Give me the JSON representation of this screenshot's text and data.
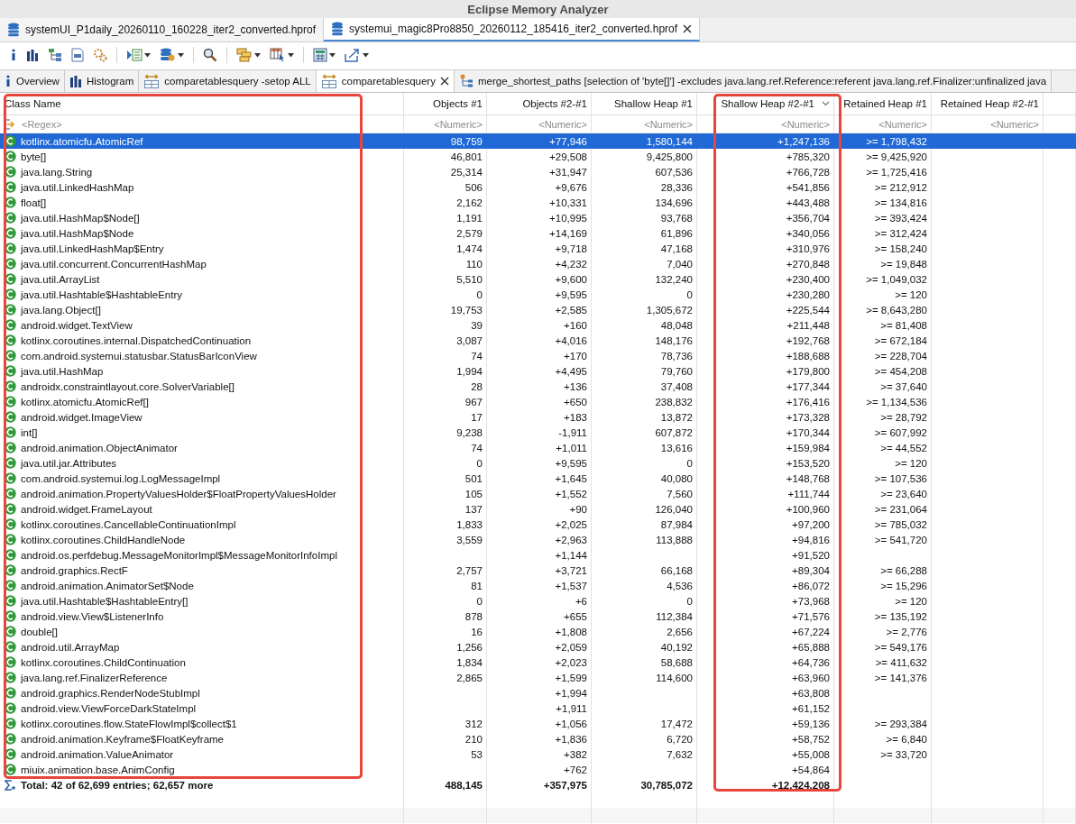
{
  "window": {
    "title": "Eclipse Memory Analyzer"
  },
  "editor_tabs": [
    {
      "label": "systemUI_P1daily_20260110_160228_iter2_converted.hprof",
      "selected": false
    },
    {
      "label": "systemui_magic8Pro8850_20260112_185416_iter2_converted.hprof",
      "selected": true
    }
  ],
  "view_tabs": [
    {
      "kind": "info",
      "label": "Overview",
      "selected": false
    },
    {
      "kind": "histogram",
      "label": "Histogram",
      "selected": false
    },
    {
      "kind": "compare",
      "label": "comparetablesquery -setop ALL",
      "selected": false
    },
    {
      "kind": "compare",
      "label": "comparetablesquery",
      "selected": true
    },
    {
      "kind": "tree",
      "label": "merge_shortest_paths [selection of 'byte[]'] -excludes java.lang.ref.Reference:referent java.lang.ref.Finalizer:unfinalized java",
      "selected": false
    }
  ],
  "table": {
    "columns": [
      {
        "label": "Class Name",
        "filter": "<Regex>",
        "sorted": false,
        "highlighted": true
      },
      {
        "label": "Objects #1",
        "filter": "<Numeric>",
        "sorted": false,
        "highlighted": false
      },
      {
        "label": "Objects #2-#1",
        "filter": "<Numeric>",
        "sorted": false,
        "highlighted": false
      },
      {
        "label": "Shallow Heap #1",
        "filter": "<Numeric>",
        "sorted": false,
        "highlighted": false
      },
      {
        "label": "Shallow Heap #2-#1",
        "filter": "<Numeric>",
        "sorted": true,
        "highlighted": true
      },
      {
        "label": "Retained Heap #1",
        "filter": "<Numeric>",
        "sorted": false,
        "highlighted": false
      },
      {
        "label": "Retained Heap #2-#1",
        "filter": "<Numeric>",
        "sorted": false,
        "highlighted": false
      }
    ],
    "rows": [
      {
        "selected": true,
        "cells": [
          "kotlinx.atomicfu.AtomicRef",
          "98,759",
          "+77,946",
          "1,580,144",
          "+1,247,136",
          ">= 1,798,432"
        ]
      },
      {
        "selected": false,
        "cells": [
          "byte[]",
          "46,801",
          "+29,508",
          "9,425,800",
          "+785,320",
          ">= 9,425,920"
        ]
      },
      {
        "selected": false,
        "cells": [
          "java.lang.String",
          "25,314",
          "+31,947",
          "607,536",
          "+766,728",
          ">= 1,725,416"
        ]
      },
      {
        "selected": false,
        "cells": [
          "java.util.LinkedHashMap",
          "506",
          "+9,676",
          "28,336",
          "+541,856",
          ">= 212,912"
        ]
      },
      {
        "selected": false,
        "cells": [
          "float[]",
          "2,162",
          "+10,331",
          "134,696",
          "+443,488",
          ">= 134,816"
        ]
      },
      {
        "selected": false,
        "cells": [
          "java.util.HashMap$Node[]",
          "1,191",
          "+10,995",
          "93,768",
          "+356,704",
          ">= 393,424"
        ]
      },
      {
        "selected": false,
        "cells": [
          "java.util.HashMap$Node",
          "2,579",
          "+14,169",
          "61,896",
          "+340,056",
          ">= 312,424"
        ]
      },
      {
        "selected": false,
        "cells": [
          "java.util.LinkedHashMap$Entry",
          "1,474",
          "+9,718",
          "47,168",
          "+310,976",
          ">= 158,240"
        ]
      },
      {
        "selected": false,
        "cells": [
          "java.util.concurrent.ConcurrentHashMap",
          "110",
          "+4,232",
          "7,040",
          "+270,848",
          ">= 19,848"
        ]
      },
      {
        "selected": false,
        "cells": [
          "java.util.ArrayList",
          "5,510",
          "+9,600",
          "132,240",
          "+230,400",
          ">= 1,049,032"
        ]
      },
      {
        "selected": false,
        "cells": [
          "java.util.Hashtable$HashtableEntry",
          "0",
          "+9,595",
          "0",
          "+230,280",
          ">= 120"
        ]
      },
      {
        "selected": false,
        "cells": [
          "java.lang.Object[]",
          "19,753",
          "+2,585",
          "1,305,672",
          "+225,544",
          ">= 8,643,280"
        ]
      },
      {
        "selected": false,
        "cells": [
          "android.widget.TextView",
          "39",
          "+160",
          "48,048",
          "+211,448",
          ">= 81,408"
        ]
      },
      {
        "selected": false,
        "cells": [
          "kotlinx.coroutines.internal.DispatchedContinuation",
          "3,087",
          "+4,016",
          "148,176",
          "+192,768",
          ">= 672,184"
        ]
      },
      {
        "selected": false,
        "cells": [
          "com.android.systemui.statusbar.StatusBarIconView",
          "74",
          "+170",
          "78,736",
          "+188,688",
          ">= 228,704"
        ]
      },
      {
        "selected": false,
        "cells": [
          "java.util.HashMap",
          "1,994",
          "+4,495",
          "79,760",
          "+179,800",
          ">= 454,208"
        ]
      },
      {
        "selected": false,
        "cells": [
          "androidx.constraintlayout.core.SolverVariable[]",
          "28",
          "+136",
          "37,408",
          "+177,344",
          ">= 37,640"
        ]
      },
      {
        "selected": false,
        "cells": [
          "kotlinx.atomicfu.AtomicRef[]",
          "967",
          "+650",
          "238,832",
          "+176,416",
          ">= 1,134,536"
        ]
      },
      {
        "selected": false,
        "cells": [
          "android.widget.ImageView",
          "17",
          "+183",
          "13,872",
          "+173,328",
          ">= 28,792"
        ]
      },
      {
        "selected": false,
        "cells": [
          "int[]",
          "9,238",
          "-1,911",
          "607,872",
          "+170,344",
          ">= 607,992"
        ]
      },
      {
        "selected": false,
        "cells": [
          "android.animation.ObjectAnimator",
          "74",
          "+1,011",
          "13,616",
          "+159,984",
          ">= 44,552"
        ]
      },
      {
        "selected": false,
        "cells": [
          "java.util.jar.Attributes",
          "0",
          "+9,595",
          "0",
          "+153,520",
          ">= 120"
        ]
      },
      {
        "selected": false,
        "cells": [
          "com.android.systemui.log.LogMessageImpl",
          "501",
          "+1,645",
          "40,080",
          "+148,768",
          ">= 107,536"
        ]
      },
      {
        "selected": false,
        "cells": [
          "android.animation.PropertyValuesHolder$FloatPropertyValuesHolder",
          "105",
          "+1,552",
          "7,560",
          "+111,744",
          ">= 23,640"
        ]
      },
      {
        "selected": false,
        "cells": [
          "android.widget.FrameLayout",
          "137",
          "+90",
          "126,040",
          "+100,960",
          ">= 231,064"
        ]
      },
      {
        "selected": false,
        "cells": [
          "kotlinx.coroutines.CancellableContinuationImpl",
          "1,833",
          "+2,025",
          "87,984",
          "+97,200",
          ">= 785,032"
        ]
      },
      {
        "selected": false,
        "cells": [
          "kotlinx.coroutines.ChildHandleNode",
          "3,559",
          "+2,963",
          "113,888",
          "+94,816",
          ">= 541,720"
        ]
      },
      {
        "selected": false,
        "cells": [
          "android.os.perfdebug.MessageMonitorImpl$MessageMonitorInfoImpl",
          null,
          "+1,144",
          null,
          "+91,520",
          null
        ]
      },
      {
        "selected": false,
        "cells": [
          "android.graphics.RectF",
          "2,757",
          "+3,721",
          "66,168",
          "+89,304",
          ">= 66,288"
        ]
      },
      {
        "selected": false,
        "cells": [
          "android.animation.AnimatorSet$Node",
          "81",
          "+1,537",
          "4,536",
          "+86,072",
          ">= 15,296"
        ]
      },
      {
        "selected": false,
        "cells": [
          "java.util.Hashtable$HashtableEntry[]",
          "0",
          "+6",
          "0",
          "+73,968",
          ">= 120"
        ]
      },
      {
        "selected": false,
        "cells": [
          "android.view.View$ListenerInfo",
          "878",
          "+655",
          "112,384",
          "+71,576",
          ">= 135,192"
        ]
      },
      {
        "selected": false,
        "cells": [
          "double[]",
          "16",
          "+1,808",
          "2,656",
          "+67,224",
          ">= 2,776"
        ]
      },
      {
        "selected": false,
        "cells": [
          "android.util.ArrayMap",
          "1,256",
          "+2,059",
          "40,192",
          "+65,888",
          ">= 549,176"
        ]
      },
      {
        "selected": false,
        "cells": [
          "kotlinx.coroutines.ChildContinuation",
          "1,834",
          "+2,023",
          "58,688",
          "+64,736",
          ">= 411,632"
        ]
      },
      {
        "selected": false,
        "cells": [
          "java.lang.ref.FinalizerReference",
          "2,865",
          "+1,599",
          "114,600",
          "+63,960",
          ">= 141,376"
        ]
      },
      {
        "selected": false,
        "cells": [
          "android.graphics.RenderNodeStubImpl",
          null,
          "+1,994",
          null,
          "+63,808",
          null
        ]
      },
      {
        "selected": false,
        "cells": [
          "android.view.ViewForceDarkStateImpl",
          null,
          "+1,911",
          null,
          "+61,152",
          null
        ]
      },
      {
        "selected": false,
        "cells": [
          "kotlinx.coroutines.flow.StateFlowImpl$collect$1",
          "312",
          "+1,056",
          "17,472",
          "+59,136",
          ">= 293,384"
        ]
      },
      {
        "selected": false,
        "cells": [
          "android.animation.Keyframe$FloatKeyframe",
          "210",
          "+1,836",
          "6,720",
          "+58,752",
          ">= 6,840"
        ]
      },
      {
        "selected": false,
        "cells": [
          "android.animation.ValueAnimator",
          "53",
          "+382",
          "7,632",
          "+55,008",
          ">= 33,720"
        ]
      },
      {
        "selected": false,
        "cells": [
          "miuix.animation.base.AnimConfig",
          null,
          "+762",
          null,
          "+54,864",
          null
        ]
      }
    ],
    "total": {
      "label": "Total: 42 of 62,699 entries; 62,657 more",
      "cells": [
        "488,145",
        "+357,975",
        "30,785,072",
        "+12,424,208"
      ]
    }
  }
}
